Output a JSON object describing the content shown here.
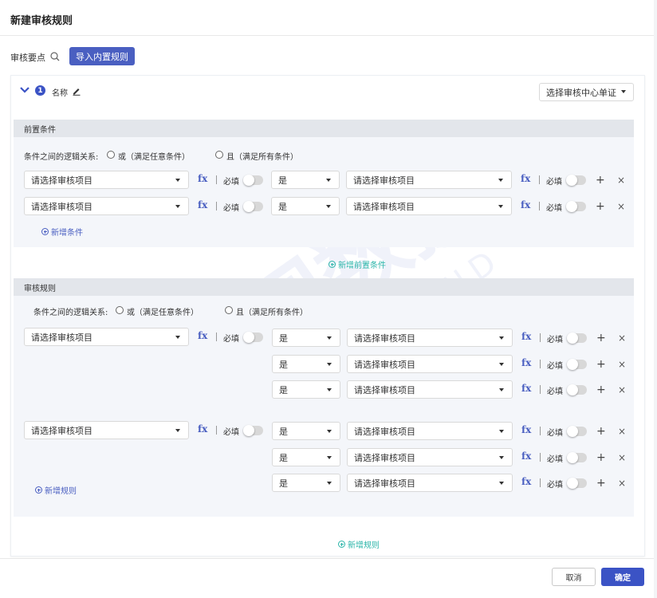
{
  "dialog": {
    "title": "新建审核规则"
  },
  "toolbar": {
    "points_label": "审核要点",
    "import_button": "导入内置规则"
  },
  "card": {
    "number": "1",
    "name_label": "名称",
    "doc_select": "选择审核中心单证"
  },
  "pre_section": {
    "title": "前置条件",
    "logic_label": "条件之间的逻辑关系:",
    "option_or": "或（满足任意条件）",
    "option_and": "且（满足所有条件）",
    "rows": [
      {
        "left": "请选择审核项目",
        "fx": "fx",
        "req": "必填",
        "op": "是",
        "right": "请选择审核项目",
        "fx2": "fx",
        "req2": "必填"
      },
      {
        "left": "请选择审核项目",
        "fx": "fx",
        "req": "必填",
        "op": "是",
        "right": "请选择审核项目",
        "fx2": "fx",
        "req2": "必填"
      }
    ],
    "add_condition": "新增条件",
    "add_pre": "新增前置条件"
  },
  "rule_section": {
    "title": "审核规则",
    "logic_label": "条件之间的逻辑关系:",
    "option_or": "或（满足任意条件）",
    "option_and": "且（满足所有条件）",
    "groups": [
      {
        "left": "请选择审核项目",
        "fx": "fx",
        "req": "必填",
        "rows": [
          {
            "op": "是",
            "right": "请选择审核项目",
            "fx2": "fx",
            "req2": "必填"
          },
          {
            "op": "是",
            "right": "请选择审核项目",
            "fx2": "fx",
            "req2": "必填"
          },
          {
            "op": "是",
            "right": "请选择审核项目",
            "fx2": "fx",
            "req2": "必填"
          }
        ]
      },
      {
        "left": "请选择审核项目",
        "fx": "fx",
        "req": "必填",
        "rows": [
          {
            "op": "是",
            "right": "请选择审核项目",
            "fx2": "fx",
            "req2": "必填"
          },
          {
            "op": "是",
            "right": "请选择审核项目",
            "fx2": "fx",
            "req2": "必填"
          },
          {
            "op": "是",
            "right": "请选择审核项目",
            "fx2": "fx",
            "req2": "必填"
          }
        ]
      }
    ],
    "add_rule_inner": "新增规则",
    "add_rule": "新增规则"
  },
  "footer": {
    "cancel": "取消",
    "ok": "确定"
  },
  "colors": {
    "primary": "#3b53c5",
    "teal": "#2bb5a9"
  }
}
